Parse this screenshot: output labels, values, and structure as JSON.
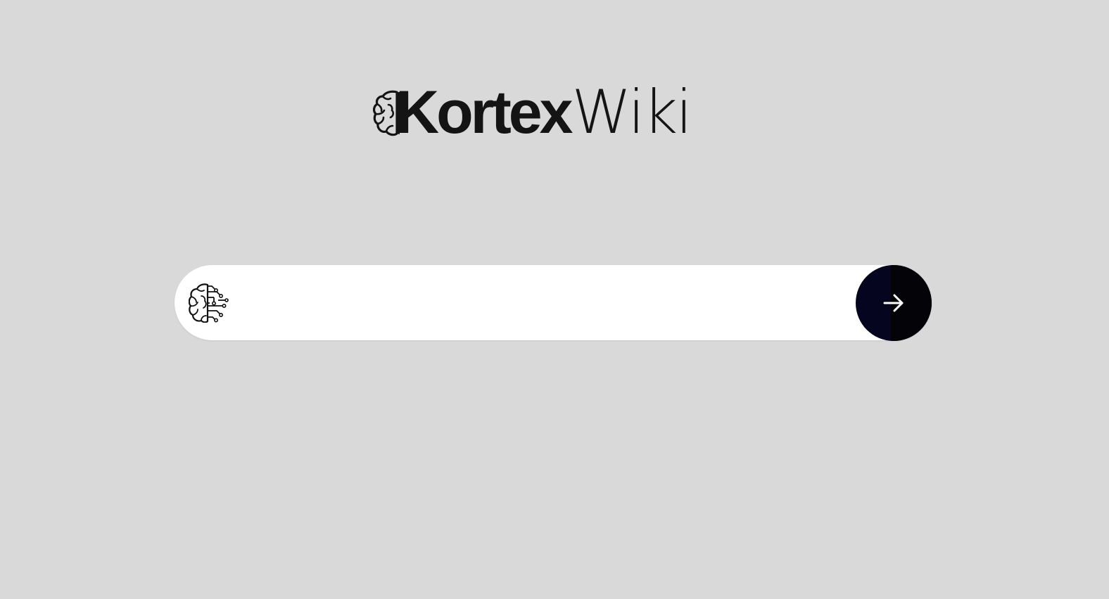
{
  "app": {
    "logo": {
      "bold_text": "Kortex",
      "light_text": "Wiki",
      "icon": "brain-icon"
    }
  },
  "search": {
    "value": "",
    "placeholder": "",
    "leading_icon": "brain-circuit-icon",
    "submit_icon": "arrow-right-icon"
  },
  "colors": {
    "background": "#d9d9d9",
    "search_bar": "#ffffff",
    "submit_button": "#06051f",
    "logo_text": "#141414"
  }
}
